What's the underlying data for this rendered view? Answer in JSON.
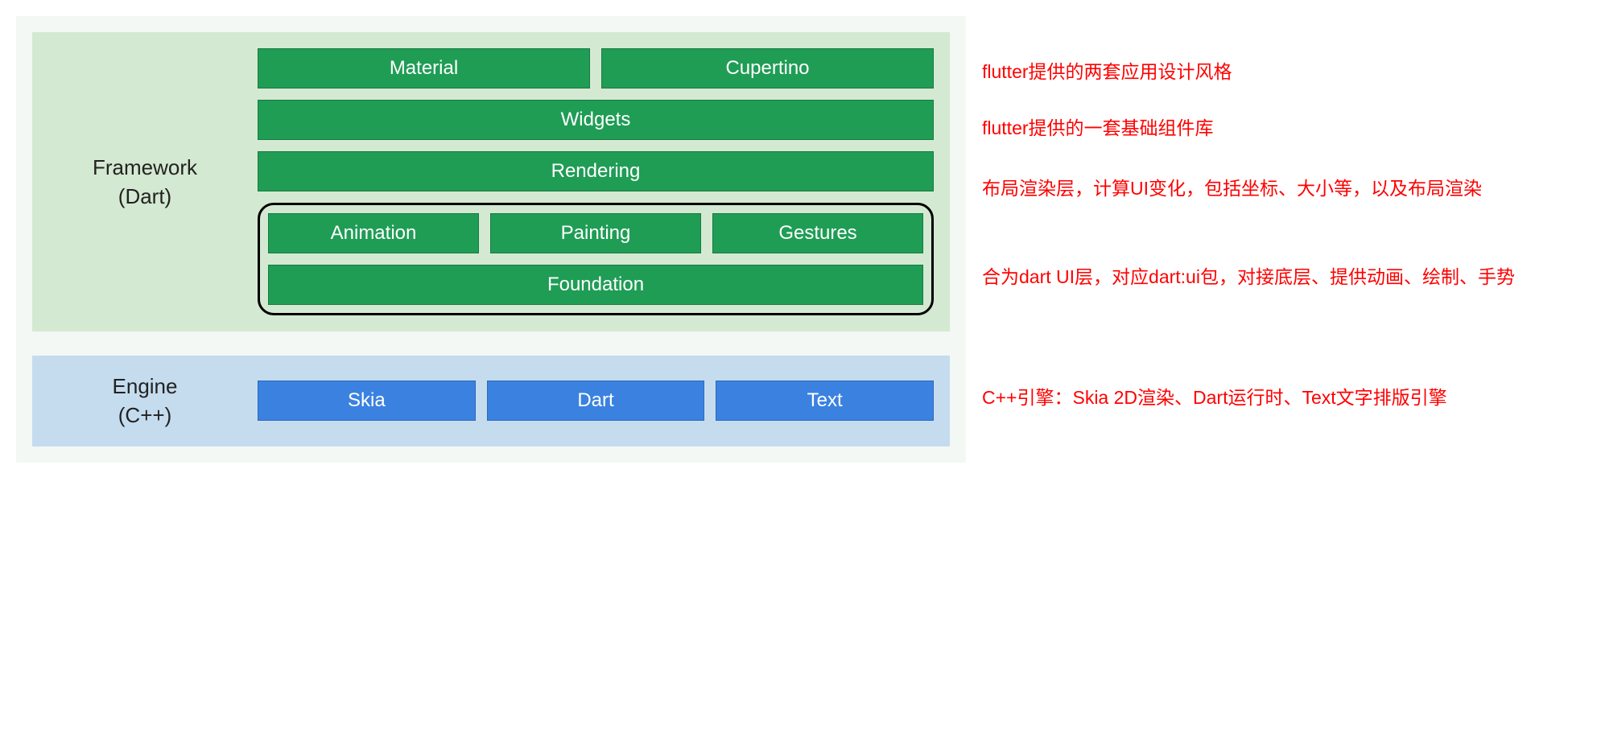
{
  "framework": {
    "label_line1": "Framework",
    "label_line2": "(Dart)",
    "row1": [
      "Material",
      "Cupertino"
    ],
    "row2": "Widgets",
    "row3": "Rendering",
    "row4": [
      "Animation",
      "Painting",
      "Gestures"
    ],
    "row5": "Foundation"
  },
  "engine": {
    "label_line1": "Engine",
    "label_line2": "(C++)",
    "row": [
      "Skia",
      "Dart",
      "Text"
    ]
  },
  "annotations": {
    "a1": "flutter提供的两套应用设计风格",
    "a2": "flutter提供的一套基础组件库",
    "a3": "布局渲染层，计算UI变化，包括坐标、大小等，以及布局渲染",
    "a4": "合为dart UI层，对应dart:ui包，对接底层、提供动画、绘制、手势",
    "a5": "C++引擎：Skia 2D渲染、Dart运行时、Text文字排版引擎"
  }
}
